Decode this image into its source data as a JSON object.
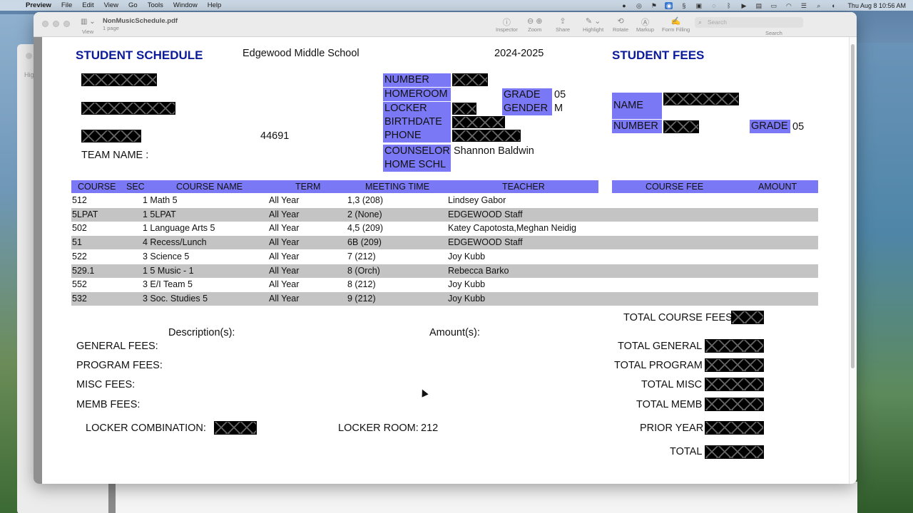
{
  "menubar": {
    "app_name": "Preview",
    "items": [
      "File",
      "Edit",
      "View",
      "Go",
      "Tools",
      "Window",
      "Help"
    ],
    "clock": "Thu Aug 8  10:56 AM"
  },
  "background_window": {
    "label": "Hig"
  },
  "toolbar": {
    "view_label": "View",
    "doc_title": "NonMusicSchedule.pdf",
    "doc_pages": "1 page",
    "buttons": [
      "Inspector",
      "Zoom",
      "Share",
      "Highlight",
      "Rotate",
      "Markup",
      "Form Filling"
    ],
    "search_placeholder": "Search",
    "search_label": "Search"
  },
  "document": {
    "schedule_title": "STUDENT SCHEDULE",
    "school": "Edgewood Middle School",
    "year": "2024-2025",
    "fees_title": "STUDENT FEES",
    "zip": "44691",
    "team_name_label": "TEAM NAME :",
    "labels": {
      "number": "NUMBER",
      "homeroom": "HOMEROOM",
      "locker": "LOCKER",
      "birthdate": "BIRTHDATE",
      "phone": "PHONE",
      "counselor": "COUNSELOR",
      "home_schl": "HOME SCHL",
      "grade": "GRADE",
      "gender": "GENDER"
    },
    "grade_value": "05",
    "gender_value": "M",
    "counselor_value": "Shannon Baldwin",
    "fees_panel": {
      "name_label": "NAME",
      "number_label": "NUMBER",
      "grade_label": "GRADE",
      "grade_value": "05"
    },
    "table": {
      "headers": [
        "COURSE",
        "SEC",
        "COURSE NAME",
        "TERM",
        "MEETING TIME",
        "TEACHER"
      ],
      "fee_headers": [
        "COURSE FEE",
        "AMOUNT"
      ],
      "rows": [
        {
          "course": "512",
          "sec_name": "1 Math 5",
          "term": "All Year",
          "meeting": "1,3 (208)",
          "teacher": "Lindsey Gabor"
        },
        {
          "course": "5LPAT",
          "sec_name": "1 5LPAT",
          "term": "All Year",
          "meeting": "2 (None)",
          "teacher": "EDGEWOOD Staff"
        },
        {
          "course": "502",
          "sec_name": "1 Language Arts 5",
          "term": "All Year",
          "meeting": "4,5 (209)",
          "teacher": "Katey Capotosta,Meghan Neidig"
        },
        {
          "course": "51",
          "sec_name": "4 Recess/Lunch",
          "term": "All Year",
          "meeting": "6B (209)",
          "teacher": "EDGEWOOD Staff"
        },
        {
          "course": "522",
          "sec_name": "3 Science 5",
          "term": "All Year",
          "meeting": "7 (212)",
          "teacher": "Joy Kubb"
        },
        {
          "course": "529.1",
          "sec_name": "1 5 Music - 1",
          "term": "All Year",
          "meeting": "8 (Orch)",
          "teacher": "Rebecca Barko"
        },
        {
          "course": "552",
          "sec_name": "3 E/I Team 5",
          "term": "All Year",
          "meeting": "8 (212)",
          "teacher": "Joy Kubb"
        },
        {
          "course": "532",
          "sec_name": "3 Soc. Studies 5",
          "term": "All Year",
          "meeting": "9 (212)",
          "teacher": "Joy Kubb"
        }
      ]
    },
    "total_course_fees": "TOTAL COURSE FEES",
    "descriptions_label": "Description(s):",
    "amounts_label": "Amount(s):",
    "fee_lines": [
      "GENERAL FEES:",
      "PROGRAM FEES:",
      "MISC FEES:",
      "MEMB FEES:"
    ],
    "totals": [
      "TOTAL GENERAL",
      "TOTAL PROGRAM",
      "TOTAL MISC",
      "TOTAL MEMB"
    ],
    "locker_combination_label": "LOCKER COMBINATION:",
    "locker_room_label": "LOCKER ROOM:",
    "locker_room_value": "212",
    "prior_year_label": "PRIOR YEAR",
    "total_label": "TOTAL"
  }
}
